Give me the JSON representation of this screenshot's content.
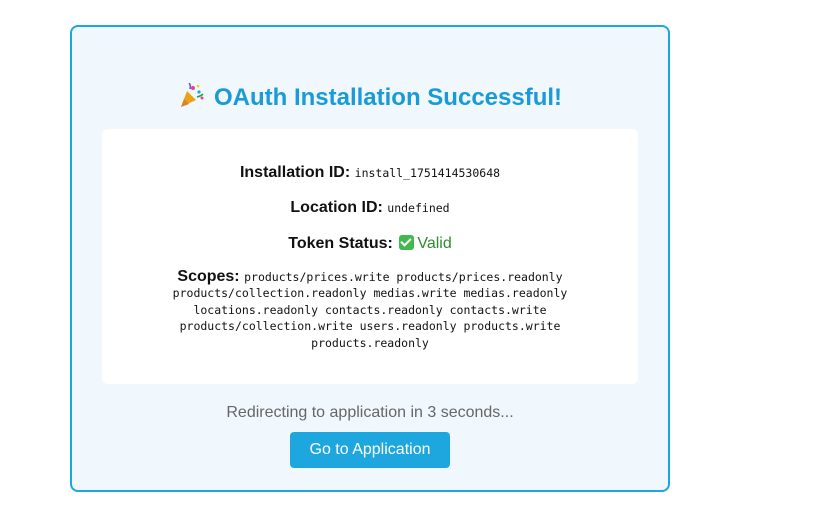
{
  "title": {
    "icon": "party-popper-icon",
    "text": "OAuth Installation Successful!"
  },
  "details": {
    "installation_id_label": "Installation ID:",
    "installation_id_value": "install_1751414530648",
    "location_id_label": "Location ID:",
    "location_id_value": "undefined",
    "token_status_label": "Token Status:",
    "token_status_icon": "check-mark-icon",
    "token_status_value": "Valid",
    "scopes_label": "Scopes:",
    "scopes_value": "products/prices.write products/prices.readonly products/collection.readonly medias.write medias.readonly locations.readonly contacts.readonly contacts.write products/collection.write users.readonly products.write products.readonly"
  },
  "redirect_text": "Redirecting to application in 3 seconds...",
  "button_label": "Go to Application",
  "colors": {
    "accent": "#1ea6df",
    "title": "#1a9ad6",
    "card_background": "#f0f8fe",
    "valid_text": "#2e8b2e"
  }
}
